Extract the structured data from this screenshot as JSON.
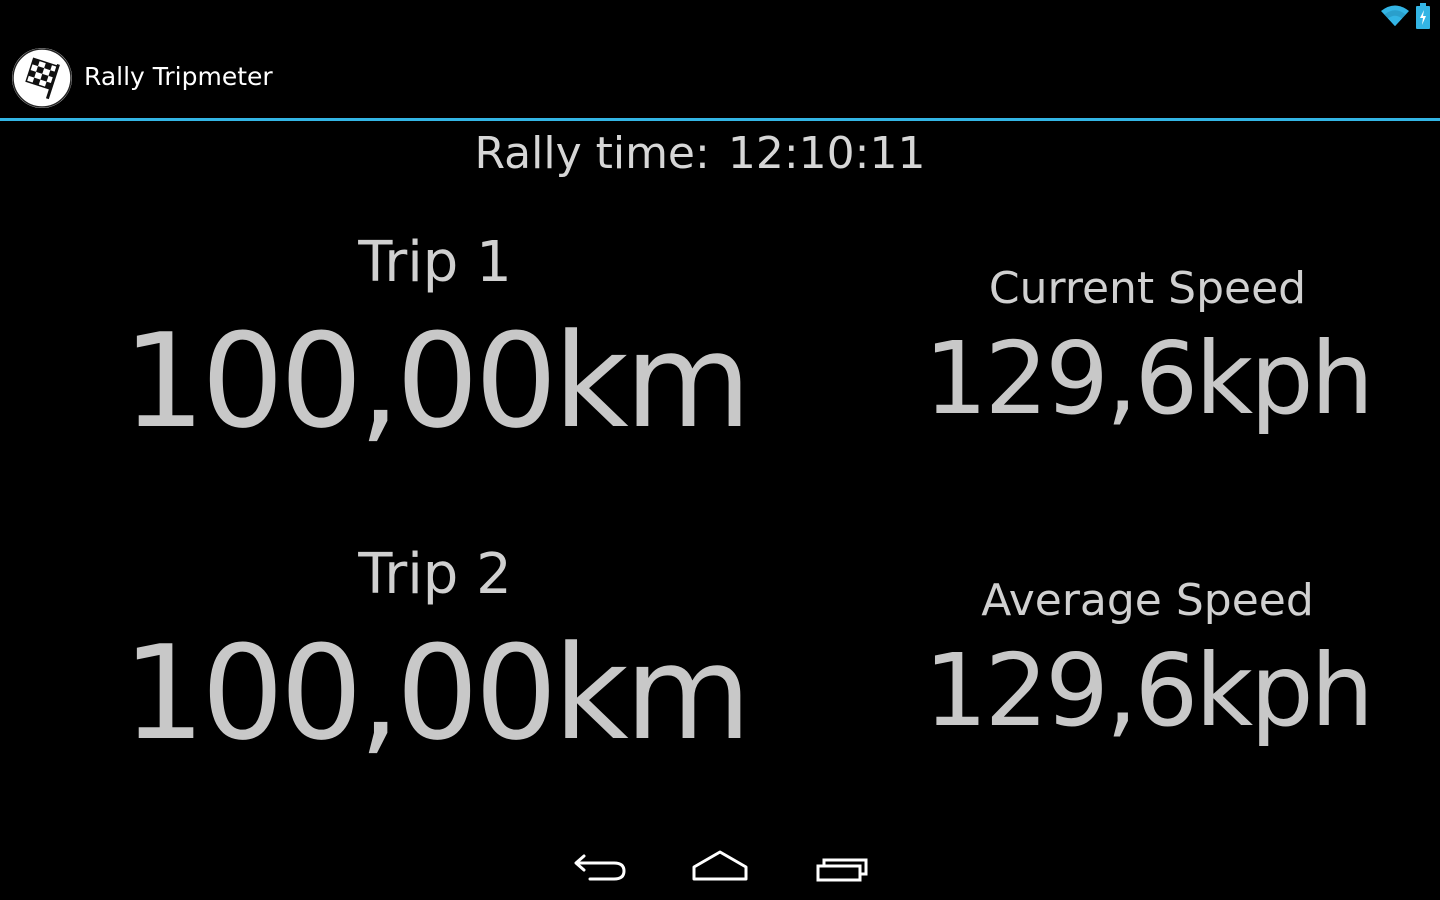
{
  "app": {
    "title": "Rally Tripmeter"
  },
  "icons": {
    "app": "checkered-flag-icon",
    "wifi": "wifi-icon",
    "battery": "battery-charging-icon",
    "back": "back-icon",
    "home": "home-icon",
    "recents": "recent-apps-icon"
  },
  "colors": {
    "accent": "#33b5e5",
    "background": "#000000",
    "text": "#c8c8c8"
  },
  "rally_time": {
    "label": "Rally time:",
    "value": "12:10:11"
  },
  "trip1": {
    "label": "Trip 1",
    "value": "100,00km"
  },
  "trip2": {
    "label": "Trip 2",
    "value": "100,00km"
  },
  "current_speed": {
    "label": "Current Speed",
    "value": "129,6kph"
  },
  "average_speed": {
    "label": "Average Speed",
    "value": "129,6kph"
  }
}
